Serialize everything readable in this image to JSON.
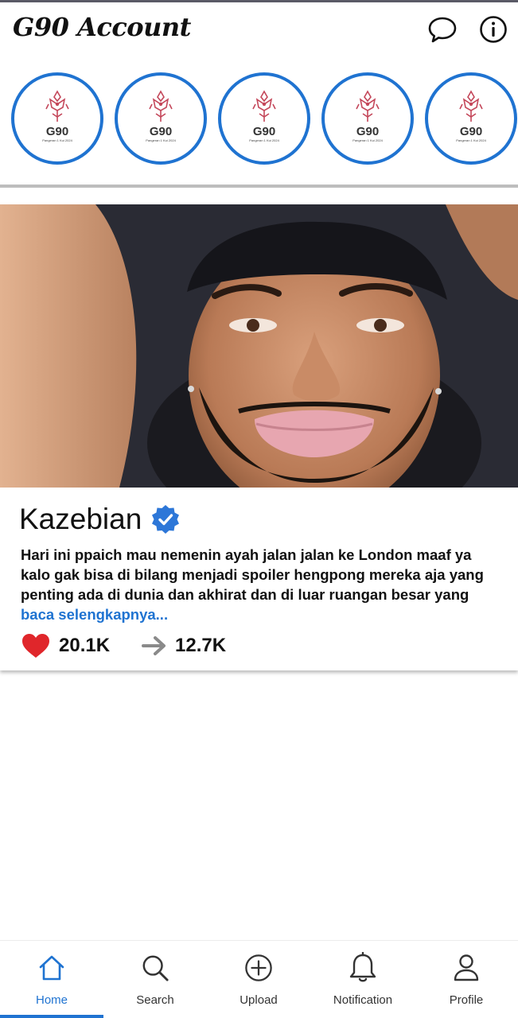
{
  "header": {
    "title": "G90 Account",
    "chat_icon": "chat-bubble-icon",
    "info_icon": "info-icon"
  },
  "stories": [
    {
      "brand": "G90",
      "sub": "Pangeran 1 Kui 2024"
    },
    {
      "brand": "G90",
      "sub": "Pangeran 1 Kui 2024"
    },
    {
      "brand": "G90",
      "sub": "Pangeran 1 Kui 2024"
    },
    {
      "brand": "G90",
      "sub": "Pangeran 1 Kui 2024"
    },
    {
      "brand": "G90",
      "sub": "Pangeran 1 Kui 2024"
    }
  ],
  "post": {
    "author": "Kazebian",
    "verified": true,
    "caption": "Hari ini ppaich mau nemenin ayah jalan jalan ke London maaf ya kalo gak bisa di bilang menjadi spoiler hengpong mereka aja yang penting ada di dunia dan akhirat dan di luar ruangan besar yang ",
    "read_more": "baca selengkapnya...",
    "likes": "20.1K",
    "shares": "12.7K"
  },
  "nav": {
    "active": "home",
    "items": [
      {
        "label": "Home",
        "icon": "home-icon"
      },
      {
        "label": "Search",
        "icon": "search-icon"
      },
      {
        "label": "Upload",
        "icon": "plus-circle-icon"
      },
      {
        "label": "Notification",
        "icon": "bell-icon"
      },
      {
        "label": "Profile",
        "icon": "user-icon"
      }
    ]
  },
  "colors": {
    "accent": "#1f73d1",
    "heart": "#e0262b",
    "divider": "#bdbdbd"
  }
}
